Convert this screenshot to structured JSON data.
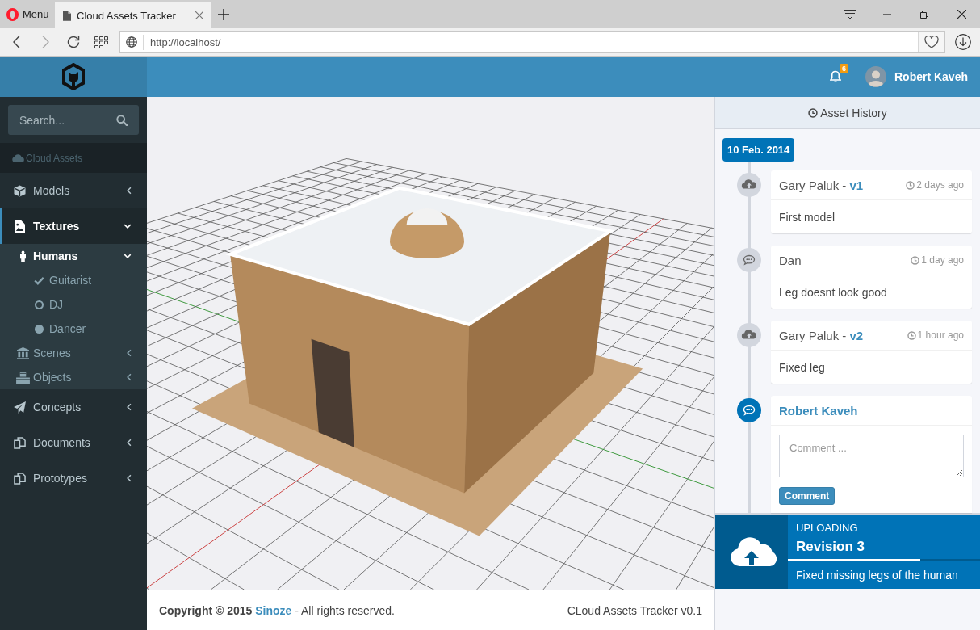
{
  "browser": {
    "menu": "Menu",
    "tabs": [
      {
        "title": "Cloud Assets Tracker",
        "selected": true
      }
    ],
    "address": "http://localhost/"
  },
  "header": {
    "notifications": "6",
    "user": "Robert Kaveh"
  },
  "sidebar": {
    "search": {
      "placeholder": "Search..."
    },
    "section": "Cloud Assets",
    "items": [
      {
        "label": "Models",
        "selected": false,
        "expanded": false
      },
      {
        "label": "Textures",
        "selected": true,
        "expanded": true,
        "children": [
          {
            "label": "Humans",
            "selected": true,
            "expanded": true,
            "children": [
              {
                "label": "Guitarist",
                "selected": false
              },
              {
                "label": "DJ",
                "selected": false
              },
              {
                "label": "Dancer",
                "selected": false
              }
            ]
          },
          {
            "label": "Scenes",
            "selected": false,
            "expanded": false
          },
          {
            "label": "Objects",
            "selected": false,
            "expanded": false
          }
        ]
      },
      {
        "label": "Concepts",
        "selected": false,
        "expanded": false
      },
      {
        "label": "Documents",
        "selected": false,
        "expanded": false
      },
      {
        "label": "Prototypes",
        "selected": false,
        "expanded": false
      }
    ]
  },
  "footer": {
    "copyright": "Copyright © 2015",
    "link": "Sinoze",
    "rights": "- All rights reserved.",
    "version": "CLoud Assets Tracker v0.1"
  },
  "history": {
    "title": "Asset History",
    "date": "10 Feb. 2014",
    "entries": [
      {
        "kind": "upload",
        "title": "Gary Paluk - **v1**",
        "time": "2 days ago",
        "body": "First model"
      },
      {
        "kind": "comment",
        "title": "Dan",
        "time": "1 day ago",
        "body": "Leg doesnt look good"
      },
      {
        "kind": "upload",
        "title": "Gary Paluk - **v2**",
        "time": "1 hour ago",
        "body": "Fixed leg"
      },
      {
        "kind": "form",
        "title": "Robert Kaveh",
        "placeholder": "Comment ...",
        "button": "Comment"
      }
    ]
  },
  "upload": {
    "status": "UPLOADING",
    "title": "Revision 3",
    "level": 0.69,
    "description": "Fixed missing legs of the human"
  }
}
